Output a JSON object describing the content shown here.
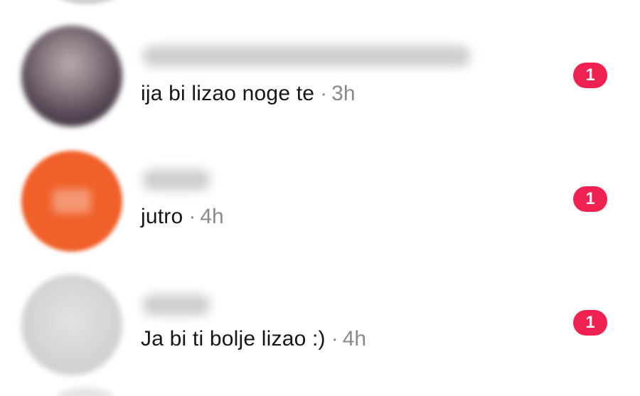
{
  "conversations": [
    {
      "avatar": "blurred-profile-photo",
      "name_visible": false,
      "message": "ija bi lizao noge te",
      "separator": "·",
      "time": "3h",
      "unread_count": "1"
    },
    {
      "avatar": "blurred-orange-initials",
      "name_visible": false,
      "message": "jutro",
      "separator": "·",
      "time": "4h",
      "unread_count": "1"
    },
    {
      "avatar": "blurred-default-gray",
      "name_visible": false,
      "message": "Ja bi ti bolje lizao :)",
      "separator": "·",
      "time": "4h",
      "unread_count": "1"
    }
  ],
  "colors": {
    "badge": "#ee2151",
    "message_text": "#161616",
    "timestamp": "#8a8a8a",
    "orange_avatar": "#f0602a",
    "background": "#ffffff"
  }
}
